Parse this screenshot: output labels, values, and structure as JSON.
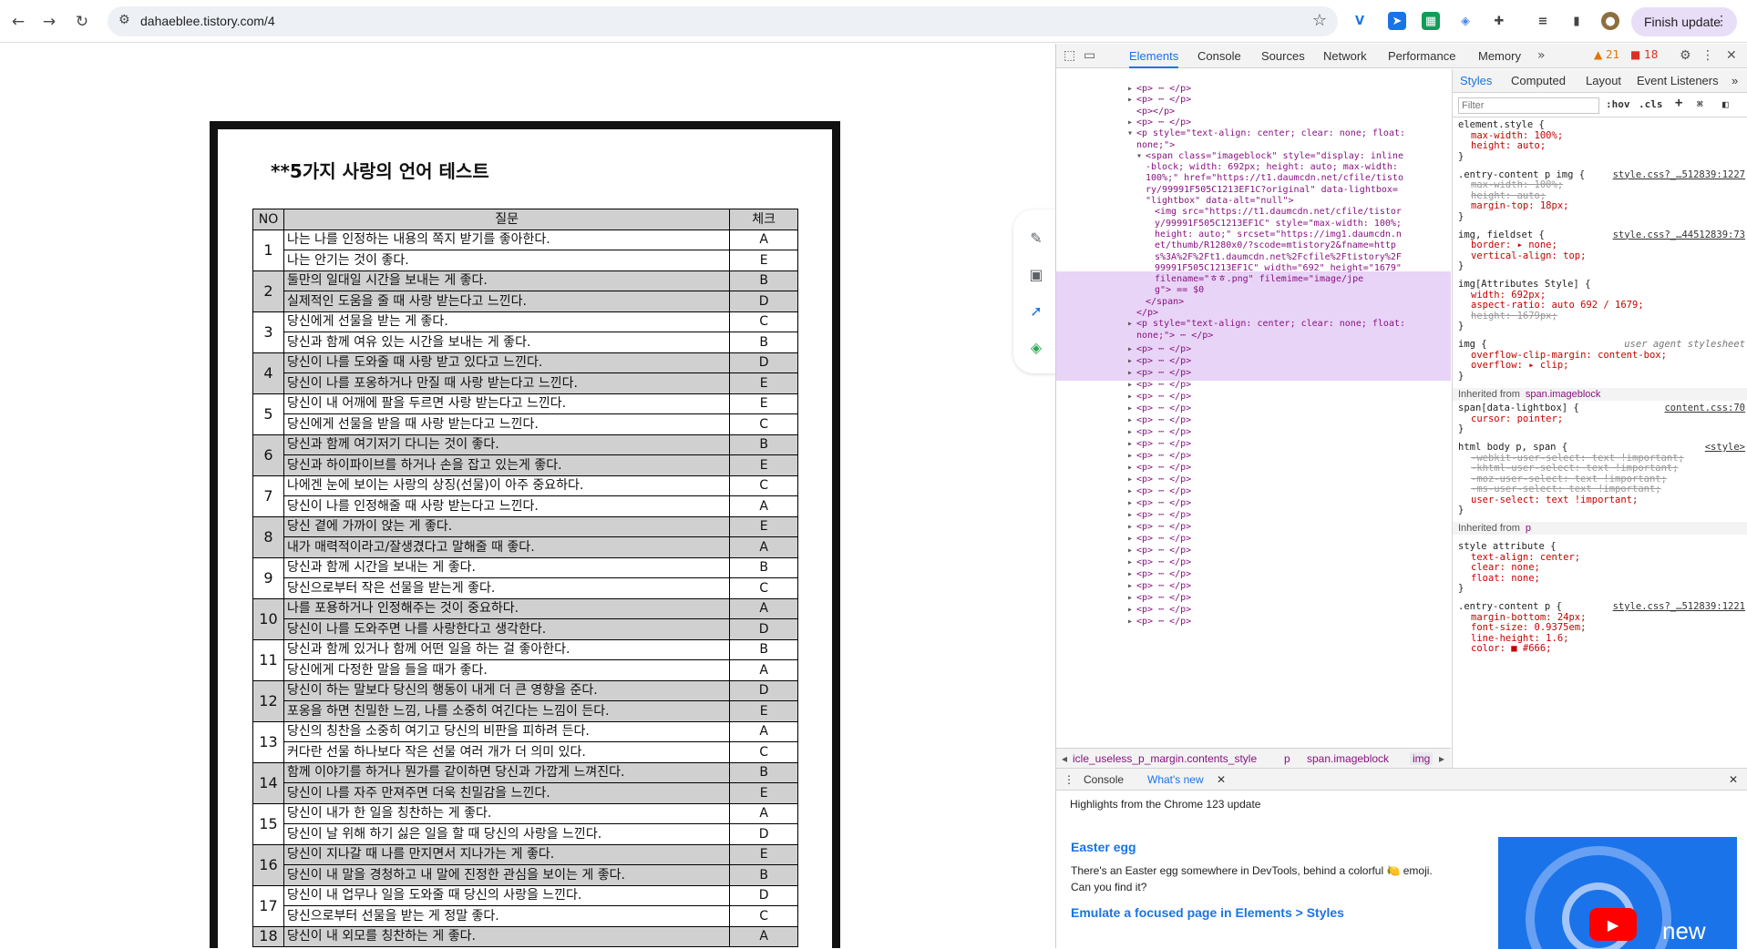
{
  "browser": {
    "url": "dahaeblee.tistory.com/4",
    "finish_update": "Finish update"
  },
  "document": {
    "title": "**5가지 사랑의 언어 테스트",
    "headers": [
      "NO",
      "질문",
      "체크"
    ],
    "rows": [
      {
        "no": "1",
        "items": [
          [
            "나는 나를 인정하는 내용의 쪽지 받기를 좋아한다.",
            "A"
          ],
          [
            "나는 안기는 것이 좋다.",
            "E"
          ]
        ]
      },
      {
        "no": "2",
        "items": [
          [
            "둘만의 일대일 시간을 보내는 게 좋다.",
            "B"
          ],
          [
            "실제적인 도움을 줄 때 사랑 받는다고 느낀다.",
            "D"
          ]
        ]
      },
      {
        "no": "3",
        "items": [
          [
            "당신에게 선물을 받는 게 좋다.",
            "C"
          ],
          [
            "당신과 함께 여유 있는 시간을 보내는 게 좋다.",
            "B"
          ]
        ]
      },
      {
        "no": "4",
        "items": [
          [
            "당신이 나를 도와줄 때 사랑 받고 있다고 느낀다.",
            "D"
          ],
          [
            "당신이 나를 포옹하거나 만질 때 사랑 받는다고 느낀다.",
            "E"
          ]
        ]
      },
      {
        "no": "5",
        "items": [
          [
            "당신이 내 어깨에 팔을 두르면 사랑 받는다고 느낀다.",
            "E"
          ],
          [
            "당신에게 선물을 받을 때 사랑 받는다고 느낀다.",
            "C"
          ]
        ]
      },
      {
        "no": "6",
        "items": [
          [
            "당신과 함께 여기저기 다니는 것이 좋다.",
            "B"
          ],
          [
            "당신과 하이파이브를 하거나 손을 잡고 있는게 좋다.",
            "E"
          ]
        ]
      },
      {
        "no": "7",
        "items": [
          [
            "나에겐 눈에 보이는 사랑의 상징(선물)이 아주 중요하다.",
            "C"
          ],
          [
            "당신이 나를 인정해줄 때 사랑 받는다고 느낀다.",
            "A"
          ]
        ]
      },
      {
        "no": "8",
        "items": [
          [
            "당신 곁에 가까이 앉는 게 좋다.",
            "E"
          ],
          [
            "내가 매력적이라고/잘생겼다고 말해줄 때 좋다.",
            "A"
          ]
        ]
      },
      {
        "no": "9",
        "items": [
          [
            "당신과 함께 시간을 보내는 게 좋다.",
            "B"
          ],
          [
            "당신으로부터 작은 선물을 받는게 좋다.",
            "C"
          ]
        ]
      },
      {
        "no": "10",
        "items": [
          [
            "나를 포용하거나 인정해주는 것이 중요하다.",
            "A"
          ],
          [
            "당신이 나를 도와주면 나를 사랑한다고 생각한다.",
            "D"
          ]
        ]
      },
      {
        "no": "11",
        "items": [
          [
            "당신과 함께 있거나 함께 어떤 일을 하는 걸 좋아한다.",
            "B"
          ],
          [
            "당신에게 다정한 말을 들을 때가 좋다.",
            "A"
          ]
        ]
      },
      {
        "no": "12",
        "items": [
          [
            "당신이 하는 말보다 당신의 행동이 내게 더 큰 영향을 준다.",
            "D"
          ],
          [
            "포옹을 하면 친밀한 느낌, 나를 소중히 여긴다는 느낌이 든다.",
            "E"
          ]
        ]
      },
      {
        "no": "13",
        "items": [
          [
            "당신의 칭찬을 소중히 여기고 당신의 비판을 피하려 든다.",
            "A"
          ],
          [
            "커다란 선물 하나보다 작은 선물 여러 개가 더 의미 있다.",
            "C"
          ]
        ]
      },
      {
        "no": "14",
        "items": [
          [
            "함께 이야기를 하거나 뭔가를 같이하면 당신과 가깝게 느껴진다.",
            "B"
          ],
          [
            "당신이 나를 자주 만져주면 더욱 친밀감을 느낀다.",
            "E"
          ]
        ]
      },
      {
        "no": "15",
        "items": [
          [
            "당신이 내가 한 일을 칭찬하는 게 좋다.",
            "A"
          ],
          [
            "당신이 날 위해 하기 싫은 일을 할 때 당신의 사랑을 느낀다.",
            "D"
          ]
        ]
      },
      {
        "no": "16",
        "items": [
          [
            "당신이 지나갈 때 나를 만지면서 지나가는 게 좋다.",
            "E"
          ],
          [
            "당신이 내 말을 경청하고 내 말에 진정한 관심을 보이는 게 좋다.",
            "B"
          ]
        ]
      },
      {
        "no": "17",
        "items": [
          [
            "당신이 내 업무나 일을 도와줄 때 당신의 사랑을 느낀다.",
            "D"
          ],
          [
            "당신으로부터 선물을 받는 게 정말 좋다.",
            "C"
          ]
        ]
      },
      {
        "no": "18",
        "items": [
          [
            "당신이 내 외모를 칭찬하는 게 좋다.",
            "A"
          ]
        ]
      }
    ]
  },
  "devtools": {
    "tabs": [
      "Elements",
      "Console",
      "Sources",
      "Network",
      "Performance",
      "Memory"
    ],
    "warnings": "21",
    "errors": "18",
    "styles_tabs": [
      "Styles",
      "Computed",
      "Layout",
      "Event Listeners"
    ],
    "filter_placeholder": "Filter",
    "hov": ":hov",
    "cls": ".cls",
    "breadcrumbs": [
      "icle_useless_p_margin.contents_style",
      "p",
      "span.imageblock",
      "img"
    ],
    "drawer_tabs": [
      "Console",
      "What's new"
    ],
    "whats_new": {
      "intro": "Highlights from the Chrome 123 update",
      "h1": "Easter egg",
      "p": "There's an Easter egg somewhere in DevTools, behind a colorful 🍋 emoji. Can you find it?",
      "h2": "Emulate a focused page in Elements > Styles",
      "video_label": "new"
    },
    "elements_lines": [
      "<p> ⋯ </p>",
      "<p> ⋯ </p>",
      "<p></p>",
      "<p> ⋯ </p>",
      "<p style=\"text-align: center; clear: none; float:",
      "none;\">",
      "<span class=\"imageblock\" style=\"display: inline",
      "-block; width: 692px;  height: auto; max-width:",
      "100%;\" href=\"https://t1.daumcdn.net/cfile/tisto",
      "ry/99991F505C1213EF1C?original\" data-lightbox=",
      "\"lightbox\" data-alt=\"null\">",
      "<img src=\"https://t1.daumcdn.net/cfile/tistor",
      "y/99991F505C1213EF1C\" style=\"max-width: 100%;",
      "height: auto;\" srcset=\"https://img1.daumcdn.n",
      "et/thumb/R1280x0/?scode=mtistory2&fname=http",
      "s%3A%2F%2Ft1.daumcdn.net%2Fcfile%2Ftistory%2F",
      "99991F505C1213EF1C\" width=\"692\" height=\"1679\"",
      "filename=\"ㅎㅎ.png\" filemime=\"image/jpe",
      "g\"> == $0",
      "</span>",
      "</p>",
      "<p style=\"text-align: center; clear: none; float:",
      "none;\"> ⋯ </p>"
    ],
    "styles_lines": [
      "element.style {",
      "max-width: 100%;",
      "height: auto;",
      "}",
      ".entry-content p img {",
      "max-width: 100%;",
      "height: auto;",
      "margin-top: 18px;",
      "}",
      "img, fieldset {",
      "border: ▸ none;",
      "vertical-align: top;",
      "}",
      "img[Attributes Style] {",
      "width: 692px;",
      "aspect-ratio: auto 692 / 1679;",
      "height: 1679px;",
      "}",
      "img {",
      "overflow-clip-margin: content-box;",
      "overflow: ▸ clip;",
      "}",
      "Inherited from",
      "span.imageblock",
      "span[data-lightbox] {",
      "cursor: pointer;",
      "}",
      "html body p, span {",
      "-webkit-user-select: text !important;",
      "-khtml-user-select: text !important;",
      "-moz-user-select: text !important;",
      "-ms-user-select: text !important;",
      "user-select: text !important;",
      "}",
      "p",
      "style attribute {",
      "text-align: center;",
      "clear: none;",
      "float: none;",
      "}",
      ".entry-content p {",
      "margin-bottom: 24px;",
      "font-size: 0.9375em;",
      "line-height: 1.6;",
      "color: ■ #666;"
    ],
    "style_sources": [
      "style.css?_…512839:1227",
      "style.css?_…44512839:73",
      "user agent stylesheet",
      "content.css:70",
      "<style>",
      "style.css?_…512839:1221"
    ]
  }
}
